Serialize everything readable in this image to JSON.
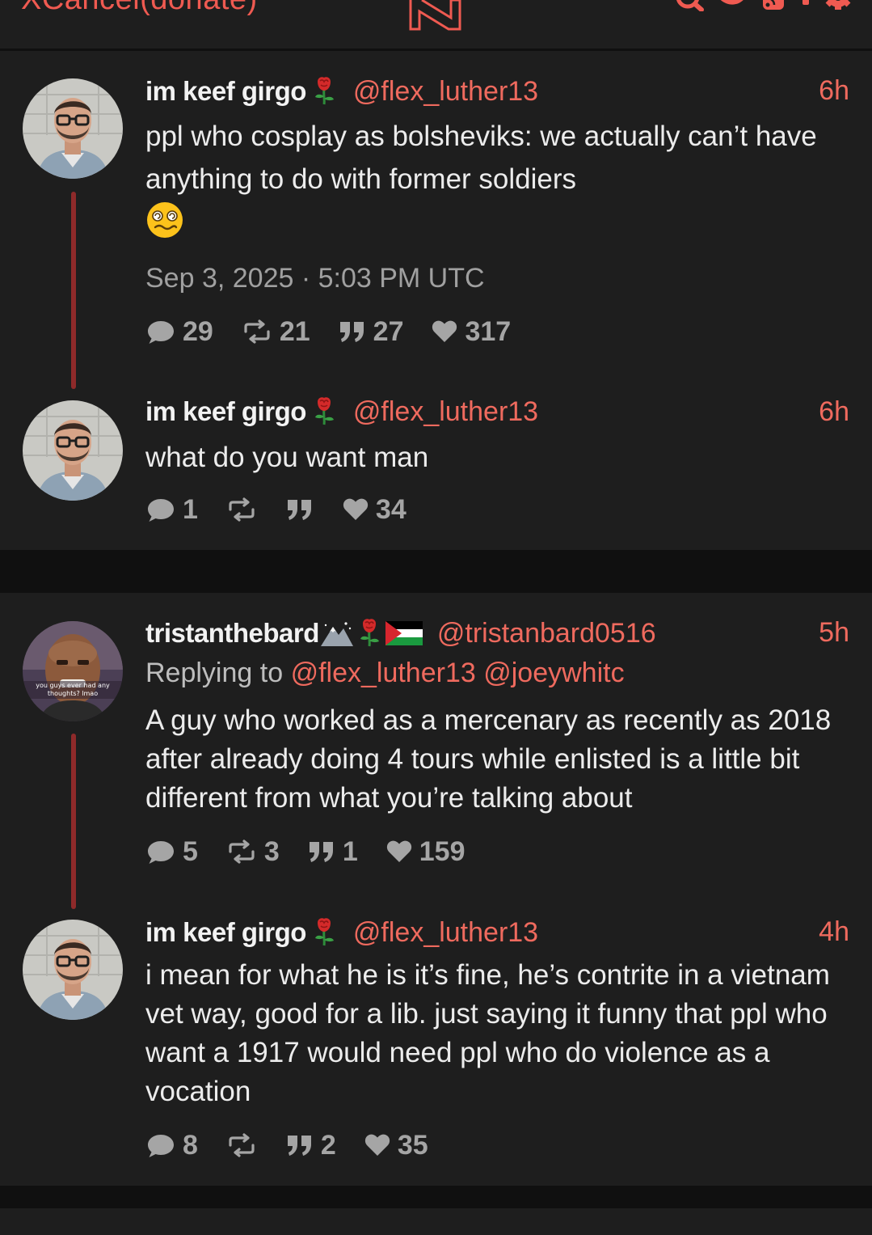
{
  "header": {
    "brand_text": "XCancel(donate)",
    "icons": [
      "nitter-logo-icon",
      "search-icon",
      "twitter-bird-icon",
      "rss-icon",
      "info-icon",
      "gear-icon"
    ]
  },
  "colors": {
    "accent": "#ef6a5e",
    "background": "#101010",
    "panel": "#1e1e1e",
    "thread_line": "#8e2a2a"
  },
  "threads": [
    {
      "tweets": [
        {
          "name": "im keef girgo",
          "name_emoji": "rose",
          "handle": "@flex_luther13",
          "time": "6h",
          "text": "ppl who cosplay as bolsheviks: we actually can’t have anything to do with former soldiers",
          "text_emoji": "woozy-face",
          "date": "Sep 3, 2025 · 5:03 PM UTC",
          "stats": {
            "comments": "29",
            "retweets": "21",
            "quotes": "27",
            "likes": "317"
          }
        },
        {
          "name": "im keef girgo",
          "name_emoji": "rose",
          "handle": "@flex_luther13",
          "time": "6h",
          "text": "what do you want man",
          "stats": {
            "comments": "1",
            "retweets": "",
            "quotes": "",
            "likes": "34"
          }
        }
      ]
    },
    {
      "tweets": [
        {
          "name": "tristanthebard",
          "name_emoji": "mountain, rose, palestine-flag",
          "handle": "@tristanbard0516",
          "time": "5h",
          "replying_label": "Replying to",
          "replying_to": [
            "@flex_luther13",
            "@joeywhitc"
          ],
          "avatar_caption": "you guys ever had any thoughts? lmao",
          "text": "A guy who worked as a mercenary as recently as 2018 after already doing 4 tours while enlisted is a little bit different from what you’re talking about",
          "stats": {
            "comments": "5",
            "retweets": "3",
            "quotes": "1",
            "likes": "159"
          }
        },
        {
          "name": "im keef girgo",
          "name_emoji": "rose",
          "handle": "@flex_luther13",
          "time": "4h",
          "text": "i mean for what he is it’s fine, he’s contrite in a vietnam vet way, good for a lib. just saying it funny that ppl who want a 1917 would need ppl who do violence as a vocation",
          "stats": {
            "comments": "8",
            "retweets": "",
            "quotes": "2",
            "likes": "35"
          }
        }
      ]
    }
  ]
}
